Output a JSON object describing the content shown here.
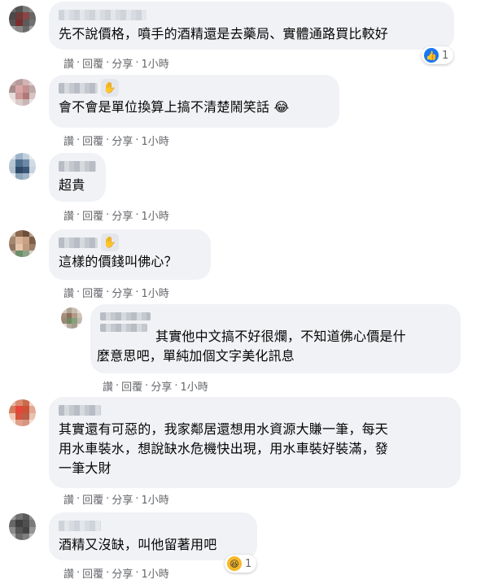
{
  "actions": {
    "like": "讚",
    "reply": "回覆",
    "share": "分享",
    "sep": "·"
  },
  "comments": [
    {
      "text": "先不說價格，噴手的酒精還是去藥局、實體通路買比較好",
      "time": "1小時",
      "reaction": {
        "type": "like-icon",
        "count": "1"
      }
    },
    {
      "text": "會不會是單位換算上搞不清楚鬧笑話 😂",
      "time": "1小時",
      "badge": "wave-icon"
    },
    {
      "text": "超貴",
      "time": "1小時"
    },
    {
      "text": "這樣的價錢叫佛心？",
      "time": "1小時",
      "badge": "wave-icon"
    },
    {
      "text": "其實他中文搞不好很爛，不知道佛心價是什\n麼意思吧，單純加個文字美化訊息",
      "time": "1小時"
    },
    {
      "text": "其實還有可惡的，我家鄰居還想用水資源大賺一筆，每天\n用水車裝水，想說缺水危機快出現，用水車裝好裝滿，發\n一筆大財",
      "time": "1小時"
    },
    {
      "text": "酒精又沒缺，叫他留著用吧",
      "time": "1小時",
      "reaction": {
        "type": "haha-icon",
        "count": "1"
      }
    }
  ],
  "colors": {
    "bubble": "#f0f2f5",
    "meta": "#65676b",
    "like": "#1877f2",
    "haha": "#f7b928"
  }
}
